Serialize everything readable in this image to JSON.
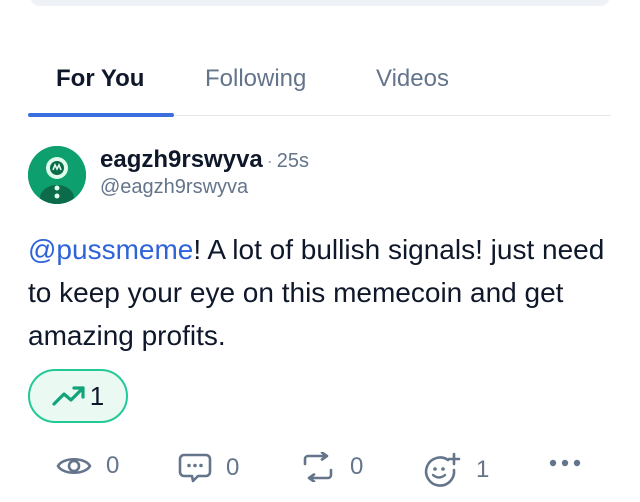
{
  "tabs": [
    {
      "label": "For You",
      "active": true
    },
    {
      "label": "Following",
      "active": false
    },
    {
      "label": "Videos",
      "active": false
    }
  ],
  "post": {
    "author_name": "eagzh9rswyva",
    "separator": "·",
    "time": "25s",
    "handle": "@eagzh9rswyva",
    "mention": "@pussmeme",
    "text": "! A lot of bullish signals! just need to keep your eye on this memecoin and get amazing profits.",
    "trend_count": "1",
    "trend_icon": "trending-up-icon"
  },
  "actions": {
    "views": "0",
    "comments": "0",
    "reposts": "0",
    "reactions": "1"
  },
  "colors": {
    "accent": "#3b6fe0",
    "mention": "#2f63d9",
    "pill_border": "#20c997",
    "pill_bg": "#eafaf3",
    "avatar_bg": "#0e9f6e"
  }
}
